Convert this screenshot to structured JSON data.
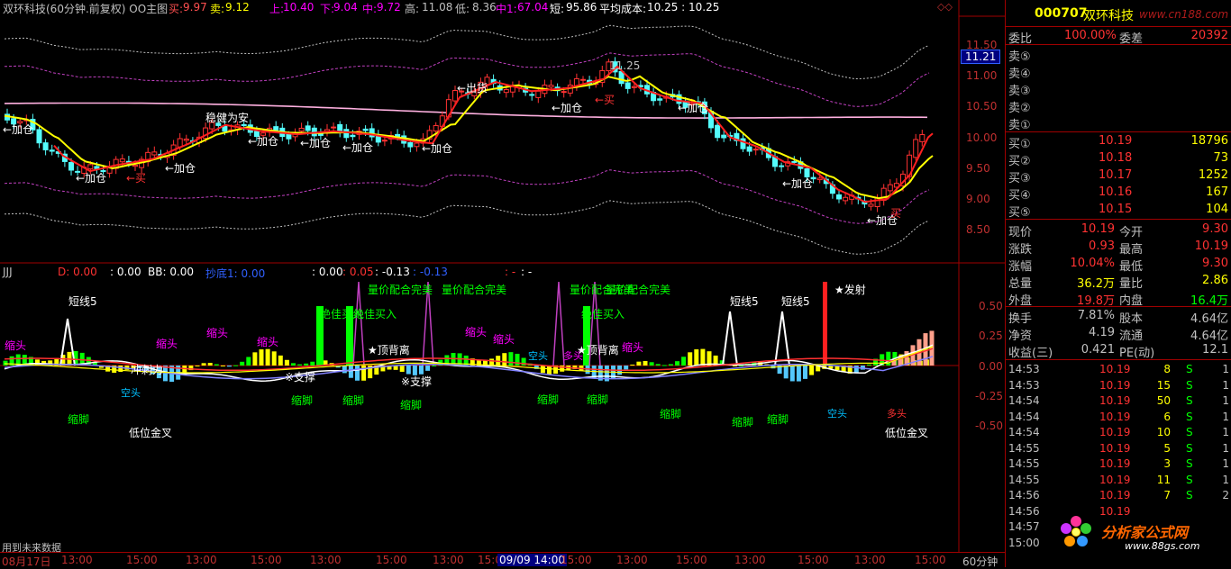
{
  "header": {
    "title": "双环科技(60分钟.前复权) OO主图",
    "buy_label": "买:",
    "buy_value": "9.97",
    "sell_label": "卖:",
    "sell_value": "9.12",
    "up_label": "上:",
    "up_value": "10.40",
    "down_label": "下:",
    "down_value": "9.04",
    "mid_label": "中:",
    "mid_value": "9.72",
    "high_label": "高:",
    "high_value": "11.08",
    "low_label": "低:",
    "low_value": "8.36",
    "mid1_label": "中1:",
    "mid1_value": "67.04",
    "short_label": "短:",
    "short_value": "95.86",
    "avgcost_label": "平均成本:",
    "avgcost_value": "10.25 : 10.25"
  },
  "main_axis": {
    "ticks": [
      "11.50",
      "11.00",
      "10.50",
      "10.00",
      "9.50",
      "9.00",
      "8.50"
    ],
    "current_price": "11.21"
  },
  "annotations_main": {
    "jiacang": "←加仓",
    "mai": "←买",
    "mai_right": "买",
    "maihei": "←出货",
    "wenjian": "稳健为安",
    "hi_label": "11.25"
  },
  "sub_header": {
    "name": "JJJ",
    "d_label": "D: 0.00",
    "v1": ": 0.00",
    "bb": "BB: 0.00",
    "chao": "抄底1: 0.00",
    "v2": ": 0.00",
    "v3": ": 0.05",
    "v4": ": -0.13",
    "v5": ": -0.13",
    "v6": ": -",
    "v7": ": -"
  },
  "sub_axis": {
    "ticks": [
      "0.50",
      "0.25",
      "0.00",
      "-0.25",
      "-0.50"
    ]
  },
  "annotations_sub": {
    "suotou": "缩头",
    "suojiao": "缩脚",
    "duanxian": "短线5",
    "diwei": "低位金叉",
    "liangjia": "量价配合完美",
    "jiajia": "绝佳买入",
    "dingbeili": "★顶背离",
    "zhicheng": "※支撑",
    "kongtou": "空头",
    "duotou": "多头",
    "fashe": "★发射",
    "chongdu": "冲刺力"
  },
  "timeline": {
    "labels": [
      "08月17日",
      "13:00",
      "15:00",
      "13:00",
      "15:00",
      "13:00",
      "15:00",
      "13:00",
      "15:00",
      "13:00",
      "15:00",
      "13:00",
      "15:00",
      "13:00",
      "15:00",
      "13:00",
      "15:00",
      "09/09 14:00",
      "15:00",
      "13:00",
      "15:00",
      "13:00",
      "15:00",
      "13:00",
      "15:00",
      "13:00",
      "15:00",
      "13:00",
      "15:00",
      "13:00",
      "15:00"
    ],
    "period": "60分钟",
    "footer_note": "用到未来数据"
  },
  "quote": {
    "code": "000707",
    "name": "双环科技",
    "watermark": "www.cn188.com",
    "weibi_label": "委比",
    "weibi_value": "100.00%",
    "weicha_label": "委差",
    "weicha_value": "20392",
    "sells": [
      {
        "label": "卖⑤",
        "price": "",
        "vol": ""
      },
      {
        "label": "卖④",
        "price": "",
        "vol": ""
      },
      {
        "label": "卖③",
        "price": "",
        "vol": ""
      },
      {
        "label": "卖②",
        "price": "",
        "vol": ""
      },
      {
        "label": "卖①",
        "price": "",
        "vol": ""
      }
    ],
    "buys": [
      {
        "label": "买①",
        "price": "10.19",
        "vol": "18796"
      },
      {
        "label": "买②",
        "price": "10.18",
        "vol": "73"
      },
      {
        "label": "买③",
        "price": "10.17",
        "vol": "1252"
      },
      {
        "label": "买④",
        "price": "10.16",
        "vol": "167"
      },
      {
        "label": "买⑤",
        "price": "10.15",
        "vol": "104"
      }
    ],
    "stats": [
      {
        "l1": "现价",
        "v1": "10.19",
        "l2": "今开",
        "v2": "9.30"
      },
      {
        "l1": "涨跌",
        "v1": "0.93",
        "l2": "最高",
        "v2": "10.19"
      },
      {
        "l1": "涨幅",
        "v1": "10.04%",
        "l2": "最低",
        "v2": "9.30"
      },
      {
        "l1": "总量",
        "v1": "36.2万",
        "l2": "量比",
        "v2": "2.86"
      },
      {
        "l1": "外盘",
        "v1": "19.8万",
        "l2": "内盘",
        "v2": "16.4万"
      }
    ],
    "stats2": [
      {
        "l1": "换手",
        "v1": "7.81%",
        "l2": "股本",
        "v2": "4.64亿"
      },
      {
        "l1": "净资",
        "v1": "4.19",
        "l2": "流通",
        "v2": "4.64亿"
      },
      {
        "l1": "收益(三)",
        "v1": "0.421",
        "l2": "PE(动)",
        "v2": "12.1"
      }
    ],
    "ticks": [
      {
        "time": "14:53",
        "price": "10.19",
        "vol": "8",
        "bs": "S",
        "n": "1"
      },
      {
        "time": "14:53",
        "price": "10.19",
        "vol": "15",
        "bs": "S",
        "n": "1"
      },
      {
        "time": "14:54",
        "price": "10.19",
        "vol": "50",
        "bs": "S",
        "n": "1"
      },
      {
        "time": "14:54",
        "price": "10.19",
        "vol": "6",
        "bs": "S",
        "n": "1"
      },
      {
        "time": "14:54",
        "price": "10.19",
        "vol": "10",
        "bs": "S",
        "n": "1"
      },
      {
        "time": "14:55",
        "price": "10.19",
        "vol": "5",
        "bs": "S",
        "n": "1"
      },
      {
        "time": "14:55",
        "price": "10.19",
        "vol": "3",
        "bs": "S",
        "n": "1"
      },
      {
        "time": "14:55",
        "price": "10.19",
        "vol": "11",
        "bs": "S",
        "n": "1"
      },
      {
        "time": "14:56",
        "price": "10.19",
        "vol": "7",
        "bs": "S",
        "n": "2"
      },
      {
        "time": "14:56",
        "price": "10.19",
        "vol": "",
        "bs": "",
        "n": ""
      },
      {
        "time": "14:57",
        "price": "",
        "vol": "",
        "bs": "",
        "n": ""
      },
      {
        "time": "15:00",
        "price": "",
        "vol": "",
        "bs": "",
        "n": ""
      }
    ],
    "logo_text": "分析家公式网",
    "logo_url": "www.88gs.com"
  },
  "colors": {
    "up": "#ff3232",
    "down": "#54fcfc",
    "yellow": "#ffff00",
    "white": "#ffffff",
    "magenta": "#ff00ff",
    "green": "#00ff00",
    "axis": "#a00000"
  }
}
